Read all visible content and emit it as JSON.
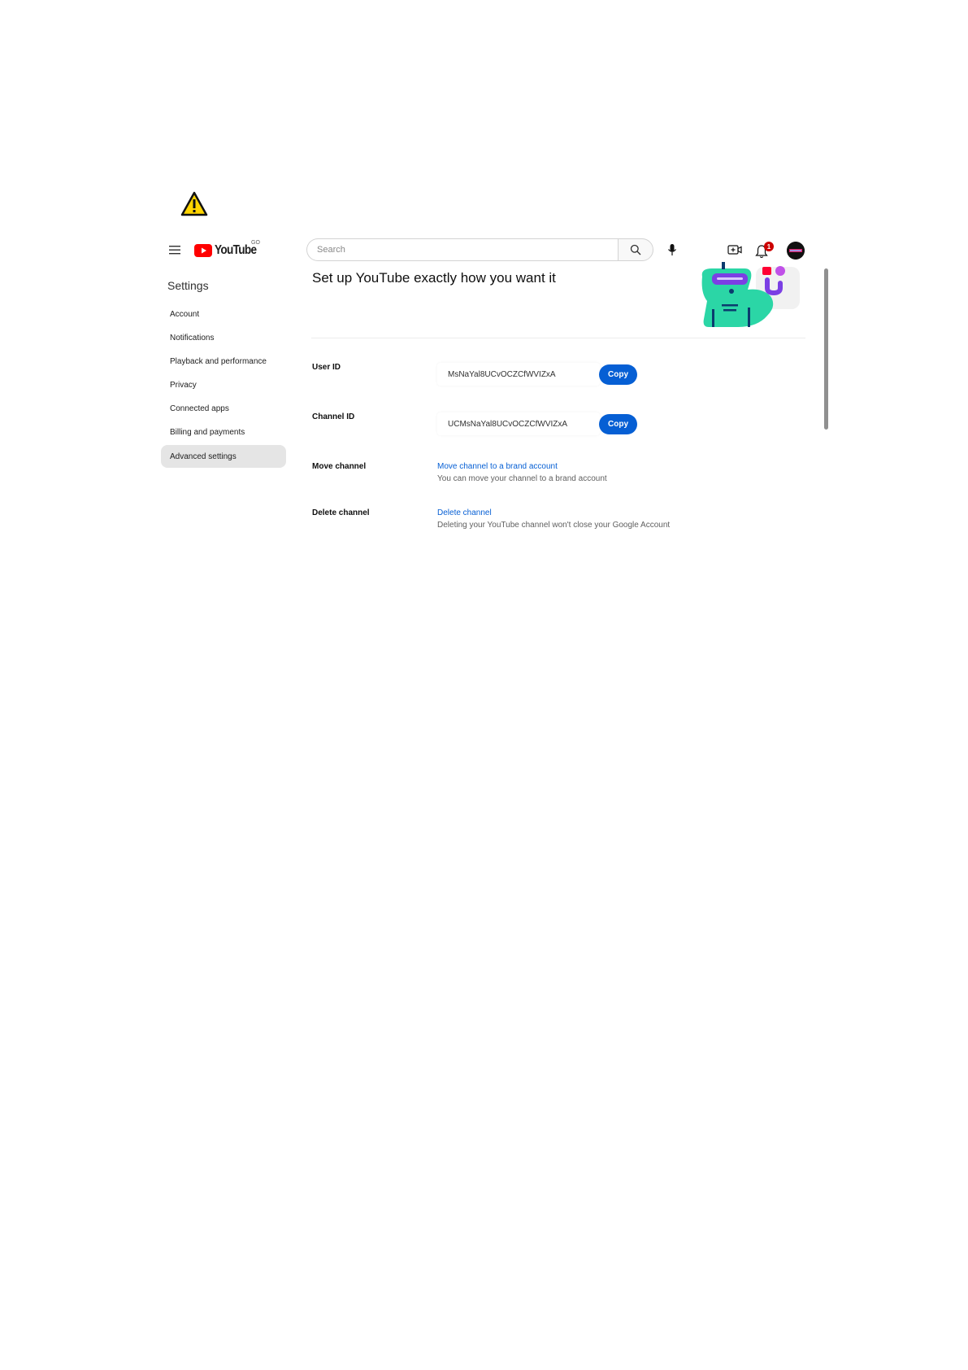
{
  "header": {
    "logo_text": "YouTube",
    "logo_superscript": "GO",
    "search_placeholder": "Search",
    "notification_count": "1"
  },
  "sidebar": {
    "heading": "Settings",
    "items": [
      {
        "label": "Account"
      },
      {
        "label": "Notifications"
      },
      {
        "label": "Playback and performance"
      },
      {
        "label": "Privacy"
      },
      {
        "label": "Connected apps"
      },
      {
        "label": "Billing and payments"
      },
      {
        "label": "Advanced settings",
        "active": true
      }
    ]
  },
  "main": {
    "title": "Set up YouTube exactly how you want it",
    "user_id": {
      "label": "User ID",
      "value": "MsNaYal8UCvOCZCfWVIZxA",
      "button": "Copy"
    },
    "channel_id": {
      "label": "Channel ID",
      "value": "UCMsNaYal8UCvOCZCfWVIZxA",
      "button": "Copy"
    },
    "move_channel": {
      "label": "Move channel",
      "link": "Move channel to a brand account",
      "description": "You can move your channel to a brand account"
    },
    "delete_channel": {
      "label": "Delete channel",
      "link": "Delete channel",
      "description": "Deleting your YouTube channel won't close your Google Account"
    }
  },
  "icons": {
    "warning": "warning-icon",
    "menu": "hamburger-icon",
    "search": "search-icon",
    "mic": "mic-icon",
    "create": "create-video-icon",
    "bell": "bell-icon"
  },
  "colors": {
    "brand_red": "#ff0000",
    "accent_blue": "#065fd4",
    "active_bg": "#e5e5e5",
    "warning_yellow": "#ffd400"
  }
}
